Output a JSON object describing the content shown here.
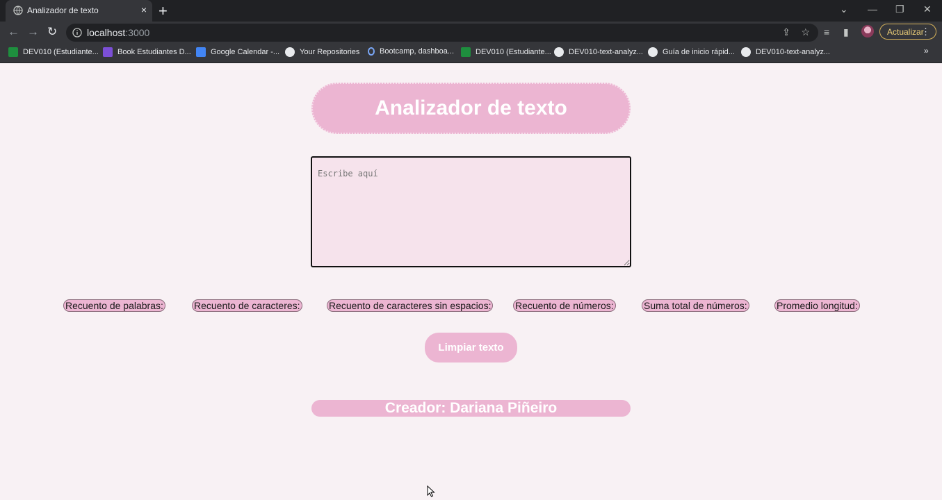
{
  "browser": {
    "tab_title": "Analizador de texto",
    "tab_close": "×",
    "new_tab": "+",
    "url_host": "localhost",
    "url_port": ":3000",
    "update_label": "Actualizar",
    "bookmarks": [
      {
        "label": "DEV010 (Estudiante...",
        "icon": "sheets-icon"
      },
      {
        "label": "Book Estudiantes D...",
        "icon": "book-icon"
      },
      {
        "label": "Google Calendar -...",
        "icon": "calendar-icon"
      },
      {
        "label": "Your Repositories",
        "icon": "github-icon"
      },
      {
        "label": "Bootcamp, dashboa...",
        "icon": "bootcamp-icon"
      },
      {
        "label": "DEV010 (Estudiante...",
        "icon": "sheets-icon"
      },
      {
        "label": "DEV010-text-analyz...",
        "icon": "github-icon"
      },
      {
        "label": "Guía de inicio rápid...",
        "icon": "github-icon"
      },
      {
        "label": "DEV010-text-analyz...",
        "icon": "github-icon"
      }
    ],
    "bookmarks_more": "»"
  },
  "app": {
    "title": "Analizador de texto",
    "textarea_placeholder": "Escribe aquí",
    "metrics": [
      "Recuento de palabras:",
      "Recuento de caracteres:",
      "Recuento de caracteres sin espacios:",
      "Recuento de números:",
      "Suma total de números:",
      "Promedio longitud:"
    ],
    "clear_button": "Limpiar texto",
    "footer": "Creador: Dariana Piñeiro"
  },
  "colors": {
    "pink_accent": "#ecb5d2",
    "page_background": "#f8f1f4",
    "textarea_background": "#f6e3ec"
  }
}
